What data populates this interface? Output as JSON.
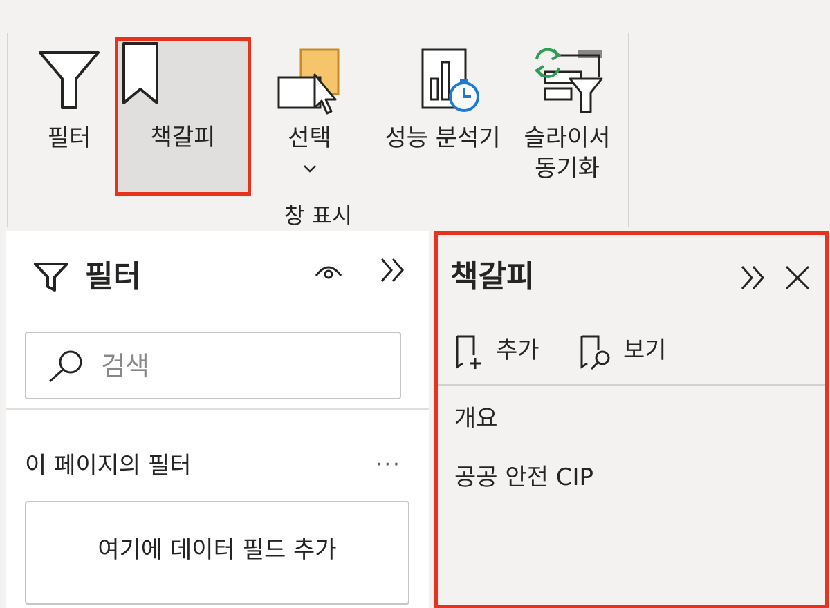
{
  "ribbon": {
    "buttons": {
      "filter": "필터",
      "bookmark": "책갈피",
      "selection": "선택",
      "performance_analyzer": "성능 분석기",
      "sync_slicers_line1": "슬라이서",
      "sync_slicers_line2": "동기화"
    },
    "group_label": "창 표시"
  },
  "filter_pane": {
    "title": "필터",
    "search_placeholder": "검색",
    "section_label": "이 페이지의 필터",
    "more": "···",
    "add_field": "여기에 데이터 필드 추가"
  },
  "bookmark_pane": {
    "title": "책갈피",
    "add": "추가",
    "view": "보기",
    "items": [
      "개요",
      "공공 안전 CIP"
    ]
  },
  "colors": {
    "highlight": "#e8321e",
    "ribbon_bg": "#f3f2f1",
    "pane_bg": "#ffffff",
    "selected_bg": "#e1dfdd",
    "text": "#252423",
    "sync_green": "#2e9e4f",
    "clock_blue": "#1f7ad6",
    "selection_orange": "#f6c46b"
  }
}
